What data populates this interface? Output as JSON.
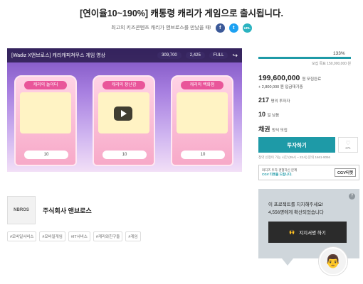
{
  "header": {
    "title": "[연이율10~190%] 캐통령 캐리가 게임으로 출시됩니다.",
    "subtitle": "최고의 키즈콘텐츠 캐리가 앤브로스를 만났을 때!"
  },
  "share": {
    "facebook": "f",
    "twitter": "t",
    "url": "URL"
  },
  "video": {
    "title": "[Wadiz X앤브로스] 캐리캐피쳐무스 게임 영상",
    "stat_coins": "309,700",
    "stat_gems": "2,425",
    "stat_full": "FULL",
    "machines": [
      {
        "label": "캐리의 놀이터",
        "coin": "10"
      },
      {
        "label": "캐리의 장난감",
        "coin": "10"
      },
      {
        "label": "캐리의 백화점",
        "coin": "10"
      }
    ]
  },
  "company": {
    "logo_text": "NBROS",
    "name": "주식회사 앤브로스"
  },
  "tags": [
    "#모바일서비스",
    "#모바일게임",
    "#IT서비스",
    "#캐리와친구들",
    "#게임"
  ],
  "funding": {
    "percent": "133%",
    "percent_value": 133,
    "goal": "모집 목표 150,000,000 원",
    "amount": "199,600,000",
    "amount_unit": "원 모집완료",
    "pending": "+ 2,800,000 원 입금대기중",
    "investors": "217",
    "investors_unit": "명의 투자자",
    "days": "10",
    "days_unit": "일 남음",
    "type": "채권",
    "type_unit": "방식 모집",
    "invest_label": "투자하기",
    "likes": "371",
    "notice": "청약 신청이 가능 시간 (09시 ~ 22시)     문의 1661-9056",
    "banner_text_1": "와디즈 투자 경험하신 분께",
    "banner_text_2": "CGV 티켓을 드립니다.",
    "banner_logo": "CGV티켓"
  },
  "support": {
    "title": "이 프로젝트를 지지해주세요!",
    "count": "4,556명에게 확산되었습니다",
    "button_label": "지지서명 하기",
    "help": "?"
  }
}
